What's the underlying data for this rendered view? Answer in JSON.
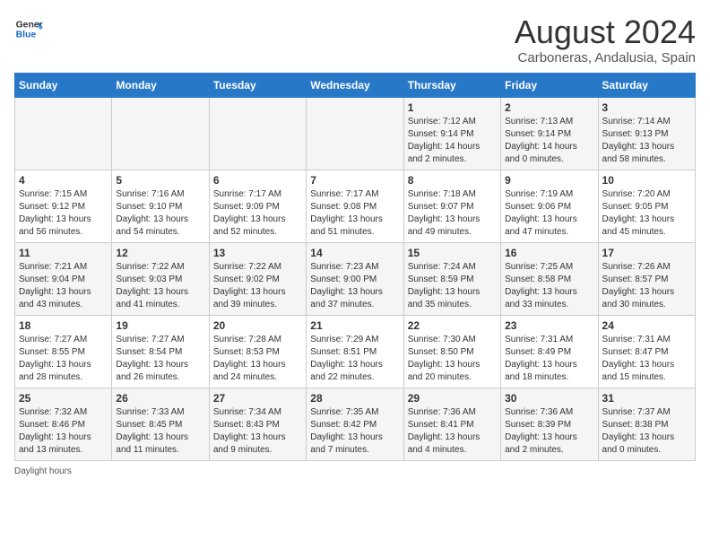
{
  "header": {
    "logo_line1": "General",
    "logo_line2": "Blue",
    "month_year": "August 2024",
    "location": "Carboneras, Andalusia, Spain"
  },
  "days_of_week": [
    "Sunday",
    "Monday",
    "Tuesday",
    "Wednesday",
    "Thursday",
    "Friday",
    "Saturday"
  ],
  "weeks": [
    [
      {
        "day": "",
        "info": ""
      },
      {
        "day": "",
        "info": ""
      },
      {
        "day": "",
        "info": ""
      },
      {
        "day": "",
        "info": ""
      },
      {
        "day": "1",
        "info": "Sunrise: 7:12 AM\nSunset: 9:14 PM\nDaylight: 14 hours\nand 2 minutes."
      },
      {
        "day": "2",
        "info": "Sunrise: 7:13 AM\nSunset: 9:14 PM\nDaylight: 14 hours\nand 0 minutes."
      },
      {
        "day": "3",
        "info": "Sunrise: 7:14 AM\nSunset: 9:13 PM\nDaylight: 13 hours\nand 58 minutes."
      }
    ],
    [
      {
        "day": "4",
        "info": "Sunrise: 7:15 AM\nSunset: 9:12 PM\nDaylight: 13 hours\nand 56 minutes."
      },
      {
        "day": "5",
        "info": "Sunrise: 7:16 AM\nSunset: 9:10 PM\nDaylight: 13 hours\nand 54 minutes."
      },
      {
        "day": "6",
        "info": "Sunrise: 7:17 AM\nSunset: 9:09 PM\nDaylight: 13 hours\nand 52 minutes."
      },
      {
        "day": "7",
        "info": "Sunrise: 7:17 AM\nSunset: 9:08 PM\nDaylight: 13 hours\nand 51 minutes."
      },
      {
        "day": "8",
        "info": "Sunrise: 7:18 AM\nSunset: 9:07 PM\nDaylight: 13 hours\nand 49 minutes."
      },
      {
        "day": "9",
        "info": "Sunrise: 7:19 AM\nSunset: 9:06 PM\nDaylight: 13 hours\nand 47 minutes."
      },
      {
        "day": "10",
        "info": "Sunrise: 7:20 AM\nSunset: 9:05 PM\nDaylight: 13 hours\nand 45 minutes."
      }
    ],
    [
      {
        "day": "11",
        "info": "Sunrise: 7:21 AM\nSunset: 9:04 PM\nDaylight: 13 hours\nand 43 minutes."
      },
      {
        "day": "12",
        "info": "Sunrise: 7:22 AM\nSunset: 9:03 PM\nDaylight: 13 hours\nand 41 minutes."
      },
      {
        "day": "13",
        "info": "Sunrise: 7:22 AM\nSunset: 9:02 PM\nDaylight: 13 hours\nand 39 minutes."
      },
      {
        "day": "14",
        "info": "Sunrise: 7:23 AM\nSunset: 9:00 PM\nDaylight: 13 hours\nand 37 minutes."
      },
      {
        "day": "15",
        "info": "Sunrise: 7:24 AM\nSunset: 8:59 PM\nDaylight: 13 hours\nand 35 minutes."
      },
      {
        "day": "16",
        "info": "Sunrise: 7:25 AM\nSunset: 8:58 PM\nDaylight: 13 hours\nand 33 minutes."
      },
      {
        "day": "17",
        "info": "Sunrise: 7:26 AM\nSunset: 8:57 PM\nDaylight: 13 hours\nand 30 minutes."
      }
    ],
    [
      {
        "day": "18",
        "info": "Sunrise: 7:27 AM\nSunset: 8:55 PM\nDaylight: 13 hours\nand 28 minutes."
      },
      {
        "day": "19",
        "info": "Sunrise: 7:27 AM\nSunset: 8:54 PM\nDaylight: 13 hours\nand 26 minutes."
      },
      {
        "day": "20",
        "info": "Sunrise: 7:28 AM\nSunset: 8:53 PM\nDaylight: 13 hours\nand 24 minutes."
      },
      {
        "day": "21",
        "info": "Sunrise: 7:29 AM\nSunset: 8:51 PM\nDaylight: 13 hours\nand 22 minutes."
      },
      {
        "day": "22",
        "info": "Sunrise: 7:30 AM\nSunset: 8:50 PM\nDaylight: 13 hours\nand 20 minutes."
      },
      {
        "day": "23",
        "info": "Sunrise: 7:31 AM\nSunset: 8:49 PM\nDaylight: 13 hours\nand 18 minutes."
      },
      {
        "day": "24",
        "info": "Sunrise: 7:31 AM\nSunset: 8:47 PM\nDaylight: 13 hours\nand 15 minutes."
      }
    ],
    [
      {
        "day": "25",
        "info": "Sunrise: 7:32 AM\nSunset: 8:46 PM\nDaylight: 13 hours\nand 13 minutes."
      },
      {
        "day": "26",
        "info": "Sunrise: 7:33 AM\nSunset: 8:45 PM\nDaylight: 13 hours\nand 11 minutes."
      },
      {
        "day": "27",
        "info": "Sunrise: 7:34 AM\nSunset: 8:43 PM\nDaylight: 13 hours\nand 9 minutes."
      },
      {
        "day": "28",
        "info": "Sunrise: 7:35 AM\nSunset: 8:42 PM\nDaylight: 13 hours\nand 7 minutes."
      },
      {
        "day": "29",
        "info": "Sunrise: 7:36 AM\nSunset: 8:41 PM\nDaylight: 13 hours\nand 4 minutes."
      },
      {
        "day": "30",
        "info": "Sunrise: 7:36 AM\nSunset: 8:39 PM\nDaylight: 13 hours\nand 2 minutes."
      },
      {
        "day": "31",
        "info": "Sunrise: 7:37 AM\nSunset: 8:38 PM\nDaylight: 13 hours\nand 0 minutes."
      }
    ]
  ],
  "footer": {
    "daylight_label": "Daylight hours"
  }
}
